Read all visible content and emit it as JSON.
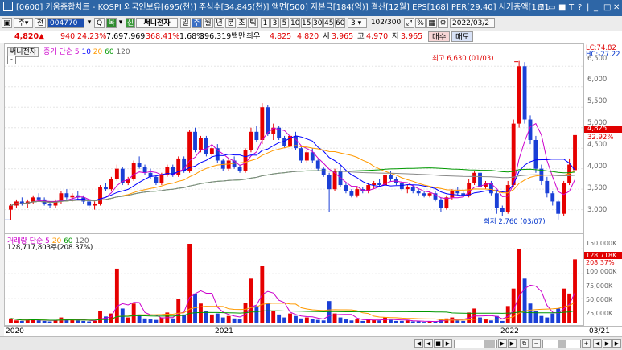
{
  "window": {
    "title": "[0600] 키움종합차트 - KOSPI 외국인보유[695(천)] 주식수[34,845(천)] 액면[500] 자본금[184(억)] 결산[12월] EPS[168] PER[29.40] 시가총액[1,71",
    "controls": [
      "⊟",
      "▭",
      "■",
      "T",
      "?",
      "|",
      "_",
      "□",
      "✕"
    ]
  },
  "toolbar": {
    "code_value": "004770",
    "flag_label": "신",
    "stock_name": "써니전자",
    "periods": [
      "일",
      "주",
      "월",
      "년",
      "분",
      "초",
      "틱"
    ],
    "selected_period": "주",
    "intervals": [
      "1",
      "3",
      "5",
      "10",
      "15",
      "30",
      "45",
      "60"
    ],
    "interval_select": "3",
    "count": "102",
    "count_total": "/300",
    "date_value": "2022/03/2",
    "labels": {
      "jong": "주",
      "jeon": "전",
      "search": "Q",
      "list": "목"
    }
  },
  "quote": {
    "price": "4,820",
    "change_arrow": "▲",
    "change": "940",
    "change_pct": "24.23%",
    "volume": "7,697,969",
    "vol_ratio": "368.41%",
    "turnover": "1.68%",
    "amount": "396,319백만",
    "preferred_label": "최우",
    "bid": "4,825",
    "ask": "4,820",
    "open_label": "시",
    "open": "3,965",
    "high_label": "고",
    "high": "4,970",
    "low_label": "저",
    "low": "3,965",
    "buy_button": "매수",
    "sell_button": "매도"
  },
  "price_pane": {
    "stock_label": "써니전자",
    "ma_legend_title": "종가 단순",
    "ma_periods": [
      "5",
      "10",
      "20",
      "60",
      "120"
    ],
    "ma_colors": [
      "#cc00cc",
      "#0000ff",
      "#ff9900",
      "#009900",
      "#666666"
    ],
    "high_annotation": "최고 6,630 (01/03)",
    "low_annotation": "최저 2,760 (03/07)",
    "lc": "LC:74.82",
    "hc": "HC:-27.22",
    "current_label": "4,825",
    "current_pct": "32.92%",
    "y_ticks": [
      "6,500",
      "6,000",
      "5,500",
      "5,000",
      "4,500",
      "4,000",
      "3,500",
      "3,000"
    ]
  },
  "volume_pane": {
    "legend_title": "거래량 단순",
    "ma_periods": [
      "5",
      "20",
      "60",
      "120"
    ],
    "value_text": "128,717,803주(208.37%)",
    "current_label": "128,718K",
    "current_pct": "208.37%",
    "y_ticks": [
      "150,000K",
      "125,000K",
      "100,000K",
      "75,000K",
      "50,000K",
      "25,000K"
    ]
  },
  "x_axis": {
    "labels": [
      "2020",
      "2021",
      "2022",
      "03/21"
    ]
  },
  "chart_data": {
    "type": "candlestick",
    "period": "weekly",
    "price_range": [
      2600,
      6800
    ],
    "volume_range": [
      0,
      160000
    ],
    "volume_unit": "K shares",
    "ohlc": [
      [
        3000,
        3150,
        2750,
        3100
      ],
      [
        3100,
        3250,
        3050,
        3200
      ],
      [
        3200,
        3300,
        3100,
        3150
      ],
      [
        3150,
        3250,
        3050,
        3200
      ],
      [
        3200,
        3350,
        3150,
        3300
      ],
      [
        3300,
        3400,
        3200,
        3250
      ],
      [
        3250,
        3300,
        3100,
        3150
      ],
      [
        3150,
        3200,
        3050,
        3100
      ],
      [
        3100,
        3250,
        3050,
        3200
      ],
      [
        3200,
        3450,
        3150,
        3400
      ],
      [
        3400,
        3500,
        3250,
        3300
      ],
      [
        3300,
        3400,
        3200,
        3350
      ],
      [
        3350,
        3450,
        3250,
        3300
      ],
      [
        3300,
        3350,
        3150,
        3200
      ],
      [
        3200,
        3250,
        3050,
        3100
      ],
      [
        3100,
        3200,
        3000,
        3150
      ],
      [
        3150,
        3600,
        3100,
        3550
      ],
      [
        3550,
        3650,
        3450,
        3500
      ],
      [
        3500,
        3800,
        3450,
        3750
      ],
      [
        3750,
        4100,
        3700,
        4000
      ],
      [
        4000,
        4050,
        3600,
        3650
      ],
      [
        3650,
        3800,
        3600,
        3750
      ],
      [
        3750,
        4200,
        3700,
        4150
      ],
      [
        4150,
        4300,
        4000,
        4050
      ],
      [
        4050,
        4100,
        3850,
        3900
      ],
      [
        3900,
        4000,
        3750,
        3800
      ],
      [
        3800,
        3850,
        3600,
        3650
      ],
      [
        3650,
        3900,
        3600,
        3850
      ],
      [
        3850,
        4100,
        3800,
        4050
      ],
      [
        4050,
        4100,
        3800,
        3850
      ],
      [
        3850,
        4300,
        3800,
        4250
      ],
      [
        4250,
        4300,
        3900,
        3950
      ],
      [
        3950,
        4950,
        3900,
        4900
      ],
      [
        4900,
        5000,
        4400,
        4450
      ],
      [
        4450,
        4800,
        4400,
        4750
      ],
      [
        4750,
        4800,
        4300,
        4350
      ],
      [
        4350,
        4550,
        4300,
        4500
      ],
      [
        4500,
        4600,
        4150,
        4200
      ],
      [
        4200,
        4250,
        3950,
        4000
      ],
      [
        4000,
        4250,
        3950,
        4200
      ],
      [
        4200,
        4300,
        4000,
        4050
      ],
      [
        4050,
        4100,
        3900,
        3950
      ],
      [
        3950,
        4500,
        3900,
        4450
      ],
      [
        4450,
        5000,
        4400,
        4900
      ],
      [
        4900,
        5050,
        4650,
        4700
      ],
      [
        4700,
        5600,
        4600,
        5500
      ],
      [
        5500,
        5550,
        4800,
        4850
      ],
      [
        4850,
        5100,
        4700,
        5000
      ],
      [
        5000,
        5050,
        4700,
        4750
      ],
      [
        4750,
        4800,
        4500,
        4550
      ],
      [
        4550,
        4850,
        4500,
        4800
      ],
      [
        4800,
        4900,
        4450,
        4500
      ],
      [
        4500,
        4550,
        4150,
        4200
      ],
      [
        4200,
        4450,
        4150,
        4400
      ],
      [
        4400,
        4500,
        4150,
        4200
      ],
      [
        4200,
        4250,
        3950,
        4000
      ],
      [
        4000,
        4050,
        3800,
        3850
      ],
      [
        3850,
        3900,
        2950,
        3500
      ],
      [
        3500,
        4000,
        3450,
        3950
      ],
      [
        3950,
        4100,
        3550,
        3600
      ],
      [
        3600,
        3650,
        3400,
        3450
      ],
      [
        3450,
        3500,
        3300,
        3350
      ],
      [
        3350,
        3550,
        3300,
        3500
      ],
      [
        3500,
        3550,
        3400,
        3450
      ],
      [
        3450,
        3650,
        3400,
        3600
      ],
      [
        3600,
        3700,
        3500,
        3650
      ],
      [
        3650,
        3750,
        3550,
        3600
      ],
      [
        3600,
        3900,
        3550,
        3850
      ],
      [
        3850,
        3950,
        3700,
        3750
      ],
      [
        3750,
        3800,
        3600,
        3650
      ],
      [
        3650,
        3700,
        3450,
        3500
      ],
      [
        3500,
        3600,
        3400,
        3550
      ],
      [
        3550,
        3600,
        3400,
        3450
      ],
      [
        3450,
        3500,
        3350,
        3400
      ],
      [
        3400,
        3450,
        3300,
        3350
      ],
      [
        3350,
        3450,
        3300,
        3400
      ],
      [
        3400,
        3450,
        3200,
        3250
      ],
      [
        3250,
        3300,
        2950,
        3050
      ],
      [
        3050,
        3350,
        3000,
        3300
      ],
      [
        3300,
        3500,
        3250,
        3450
      ],
      [
        3450,
        3550,
        3350,
        3400
      ],
      [
        3400,
        3450,
        3300,
        3350
      ],
      [
        3350,
        3750,
        3300,
        3650
      ],
      [
        3650,
        3950,
        3600,
        3900
      ],
      [
        3900,
        3950,
        3500,
        3550
      ],
      [
        3550,
        3700,
        3500,
        3650
      ],
      [
        3650,
        3700,
        3350,
        3400
      ],
      [
        3400,
        3450,
        2900,
        3050
      ],
      [
        3050,
        3100,
        2850,
        2950
      ],
      [
        2950,
        3700,
        2900,
        3600
      ],
      [
        3600,
        5200,
        3550,
        5100
      ],
      [
        5100,
        6630,
        5000,
        6500
      ],
      [
        6500,
        6600,
        5100,
        5200
      ],
      [
        5200,
        5300,
        4600,
        4700
      ],
      [
        4700,
        4800,
        3900,
        4000
      ],
      [
        4000,
        4100,
        3600,
        3700
      ],
      [
        3700,
        3800,
        3300,
        3400
      ],
      [
        3400,
        3450,
        3100,
        3200
      ],
      [
        3200,
        3250,
        2760,
        2900
      ],
      [
        2900,
        3700,
        2850,
        3650
      ],
      [
        3650,
        4250,
        3600,
        4100
      ],
      [
        3965,
        4970,
        3965,
        4820
      ]
    ],
    "volumes": [
      10000,
      6000,
      5000,
      7000,
      9000,
      6000,
      5000,
      4000,
      6000,
      12000,
      8000,
      7000,
      6000,
      5000,
      4000,
      5000,
      25000,
      14000,
      20000,
      110000,
      30000,
      12000,
      40000,
      18000,
      10000,
      8000,
      7000,
      12000,
      22000,
      10000,
      50000,
      18000,
      160000,
      60000,
      40000,
      25000,
      18000,
      20000,
      12000,
      15000,
      10000,
      8000,
      42000,
      90000,
      35000,
      115000,
      40000,
      25000,
      18000,
      12000,
      20000,
      15000,
      10000,
      12000,
      9000,
      7000,
      6000,
      45000,
      20000,
      12000,
      8000,
      6000,
      8000,
      5000,
      9000,
      7000,
      6000,
      12000,
      7000,
      5000,
      5000,
      6000,
      4000,
      4000,
      3000,
      4000,
      4000,
      9000,
      10000,
      12000,
      6000,
      5000,
      22000,
      30000,
      12000,
      8000,
      6000,
      15000,
      5000,
      35000,
      70000,
      150000,
      90000,
      40000,
      25000,
      15000,
      12000,
      20000,
      30000,
      70000,
      60000,
      128718
    ]
  }
}
